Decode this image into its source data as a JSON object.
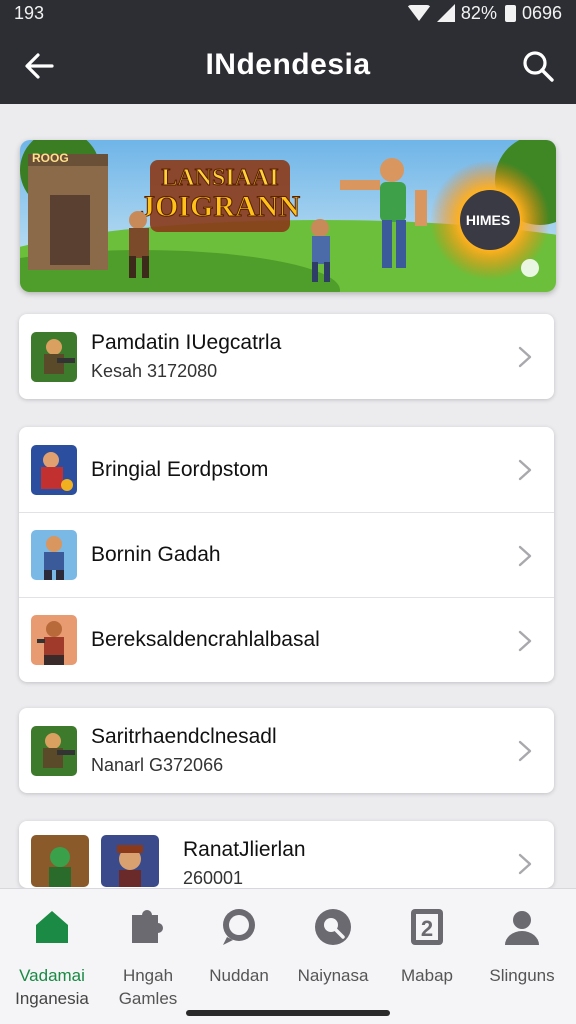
{
  "status": {
    "time": "193",
    "battery": "82%",
    "extra": "0696"
  },
  "header": {
    "title": "INdendesia",
    "back_icon": "arrow-left-icon",
    "search_icon": "search-icon"
  },
  "banner": {
    "headline_1": "LANSIAAI",
    "headline_2": "JOIGRANN",
    "badge": "ROOG",
    "tag": "HIMES"
  },
  "cards": [
    {
      "rows": [
        {
          "name": "Pamdatin IUegcatrla",
          "sub": "Kesah 3172080"
        }
      ]
    },
    {
      "rows": [
        {
          "name": "Bringial Eordpstom"
        },
        {
          "name": "Bornin Gadah"
        },
        {
          "name": "Bereksaldencrahlalbasal"
        }
      ]
    },
    {
      "rows": [
        {
          "name": "Saritrhaendclnesadl",
          "sub": "Nanarl G372066"
        }
      ]
    },
    {
      "rows": [
        {
          "name": "RanatJlierlan",
          "sub": "260001"
        }
      ]
    }
  ],
  "nav": [
    {
      "l1": "Vadamai",
      "l2": "Inganesia",
      "icon": "home-icon",
      "active": true
    },
    {
      "l1": "Hngah",
      "l2": "Gamles",
      "icon": "puzzle-icon"
    },
    {
      "l1": "Nuddan",
      "l2": "",
      "icon": "chat-icon"
    },
    {
      "l1": "Naiynasa",
      "l2": "",
      "icon": "search-circle-icon"
    },
    {
      "l1": "Mabap",
      "l2": "",
      "icon": "badge-2-icon"
    },
    {
      "l1": "Slinguns",
      "l2": "",
      "icon": "user-icon"
    }
  ],
  "colors": {
    "bar": "#2c2e33",
    "accent": "#1a8a44",
    "background": "#ececef"
  }
}
